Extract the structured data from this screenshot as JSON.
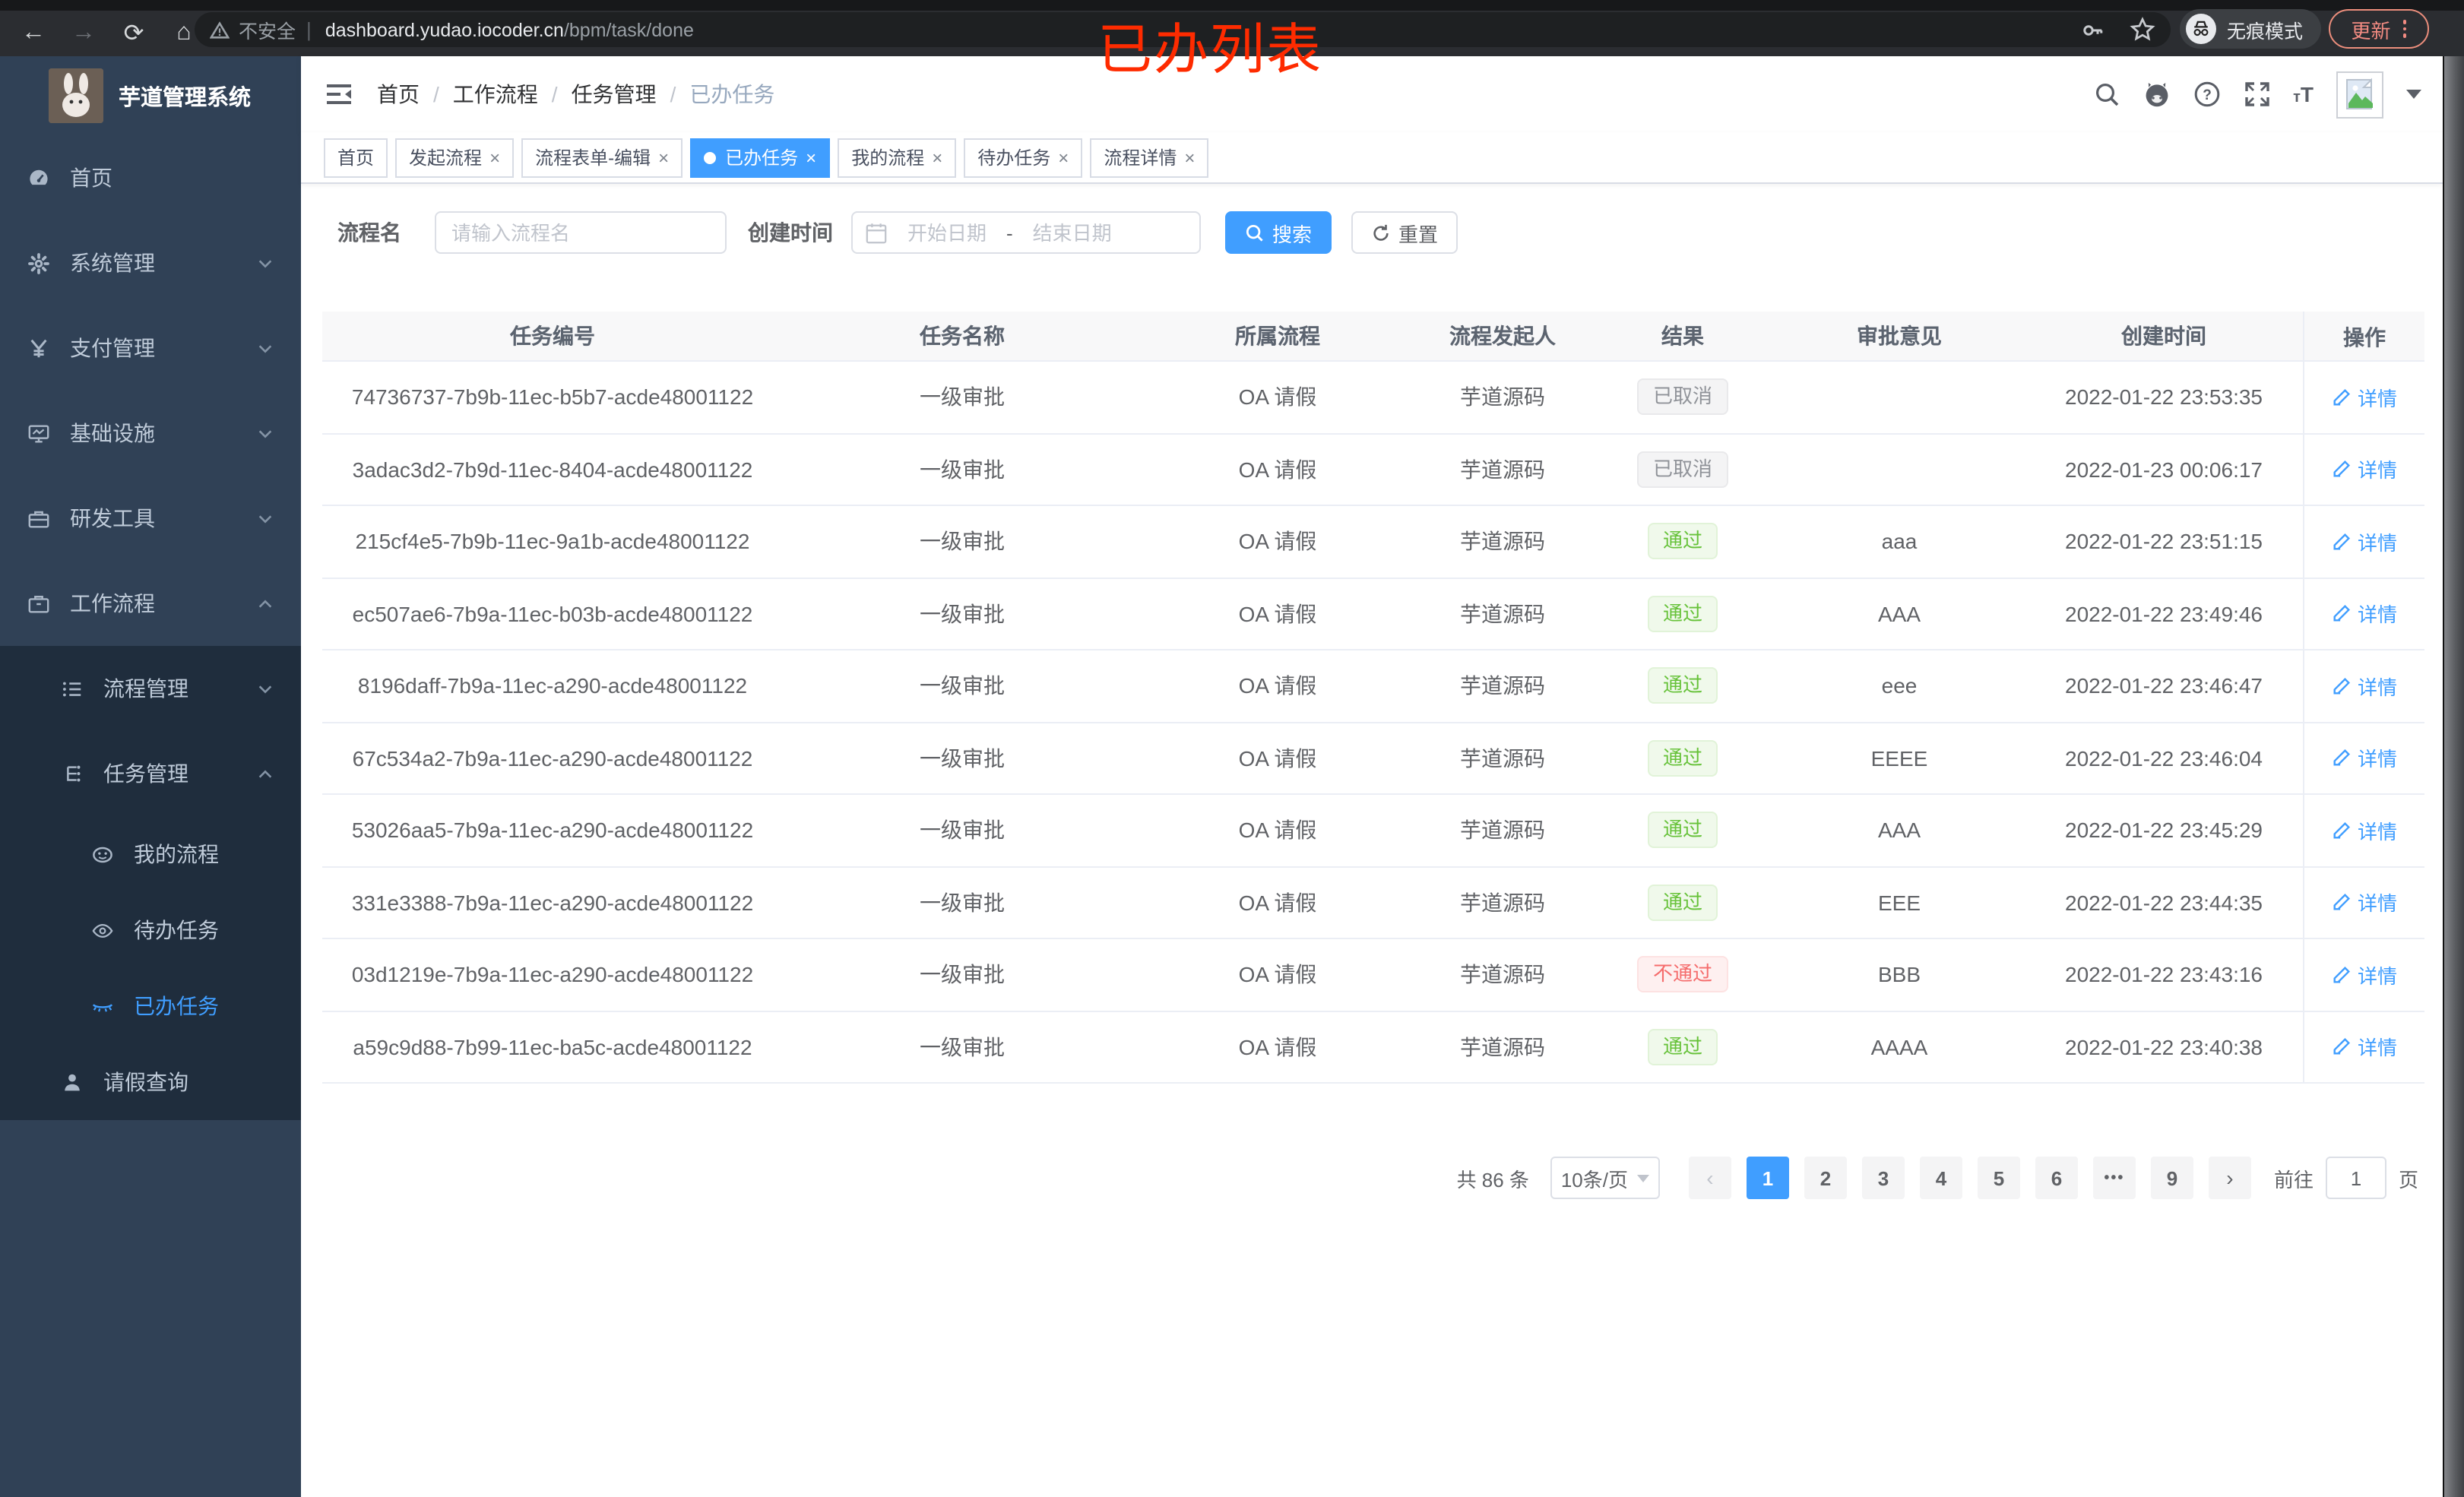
{
  "annotation": {
    "text": "已办列表"
  },
  "browser": {
    "security": "不安全",
    "url_host": "dashboard.yudao.iocoder.cn",
    "url_path": "/bpm/task/done",
    "incognito_label": "无痕模式",
    "update_label": "更新"
  },
  "sidebar": {
    "title": "芋道管理系统",
    "items": [
      {
        "label": "首页"
      },
      {
        "label": "系统管理"
      },
      {
        "label": "支付管理"
      },
      {
        "label": "基础设施"
      },
      {
        "label": "研发工具"
      },
      {
        "label": "工作流程"
      },
      {
        "label": "流程管理"
      },
      {
        "label": "任务管理"
      },
      {
        "label": "我的流程"
      },
      {
        "label": "待办任务"
      },
      {
        "label": "已办任务"
      },
      {
        "label": "请假查询"
      }
    ]
  },
  "breadcrumb": {
    "items": [
      "首页",
      "工作流程",
      "任务管理",
      "已办任务"
    ],
    "separator": "/"
  },
  "tabs": [
    {
      "label": "首页"
    },
    {
      "label": "发起流程",
      "close": "×"
    },
    {
      "label": "流程表单-编辑",
      "close": "×"
    },
    {
      "label": "已办任务",
      "close": "×",
      "active": true
    },
    {
      "label": "我的流程",
      "close": "×"
    },
    {
      "label": "待办任务",
      "close": "×"
    },
    {
      "label": "流程详情",
      "close": "×"
    }
  ],
  "filter": {
    "name_label": "流程名",
    "name_placeholder": "请输入流程名",
    "date_label": "创建时间",
    "date_start_placeholder": "开始日期",
    "date_separator": "-",
    "date_end_placeholder": "结束日期",
    "search_label": "搜索",
    "reset_label": "重置"
  },
  "table": {
    "columns": [
      "任务编号",
      "任务名称",
      "所属流程",
      "流程发起人",
      "结果",
      "审批意见",
      "创建时间",
      "操作"
    ],
    "rows": [
      {
        "id": "74736737-7b9b-11ec-b5b7-acde48001122",
        "name": "一级审批",
        "process": "OA 请假",
        "starter": "芋道源码",
        "result": "已取消",
        "result_type": "info",
        "opinion": "",
        "created": "2022-01-22 23:53:35",
        "action_label": "详情"
      },
      {
        "id": "3adac3d2-7b9d-11ec-8404-acde48001122",
        "name": "一级审批",
        "process": "OA 请假",
        "starter": "芋道源码",
        "result": "已取消",
        "result_type": "info",
        "opinion": "",
        "created": "2022-01-23 00:06:17",
        "action_label": "详情"
      },
      {
        "id": "215cf4e5-7b9b-11ec-9a1b-acde48001122",
        "name": "一级审批",
        "process": "OA 请假",
        "starter": "芋道源码",
        "result": "通过",
        "result_type": "success",
        "opinion": "aaa",
        "created": "2022-01-22 23:51:15",
        "action_label": "详情"
      },
      {
        "id": "ec507ae6-7b9a-11ec-b03b-acde48001122",
        "name": "一级审批",
        "process": "OA 请假",
        "starter": "芋道源码",
        "result": "通过",
        "result_type": "success",
        "opinion": "AAA",
        "created": "2022-01-22 23:49:46",
        "action_label": "详情"
      },
      {
        "id": "8196daff-7b9a-11ec-a290-acde48001122",
        "name": "一级审批",
        "process": "OA 请假",
        "starter": "芋道源码",
        "result": "通过",
        "result_type": "success",
        "opinion": "eee",
        "created": "2022-01-22 23:46:47",
        "action_label": "详情"
      },
      {
        "id": "67c534a2-7b9a-11ec-a290-acde48001122",
        "name": "一级审批",
        "process": "OA 请假",
        "starter": "芋道源码",
        "result": "通过",
        "result_type": "success",
        "opinion": "EEEE",
        "created": "2022-01-22 23:46:04",
        "action_label": "详情"
      },
      {
        "id": "53026aa5-7b9a-11ec-a290-acde48001122",
        "name": "一级审批",
        "process": "OA 请假",
        "starter": "芋道源码",
        "result": "通过",
        "result_type": "success",
        "opinion": "AAA",
        "created": "2022-01-22 23:45:29",
        "action_label": "详情"
      },
      {
        "id": "331e3388-7b9a-11ec-a290-acde48001122",
        "name": "一级审批",
        "process": "OA 请假",
        "starter": "芋道源码",
        "result": "通过",
        "result_type": "success",
        "opinion": "EEE",
        "created": "2022-01-22 23:44:35",
        "action_label": "详情"
      },
      {
        "id": "03d1219e-7b9a-11ec-a290-acde48001122",
        "name": "一级审批",
        "process": "OA 请假",
        "starter": "芋道源码",
        "result": "不通过",
        "result_type": "danger",
        "opinion": "BBB",
        "created": "2022-01-22 23:43:16",
        "action_label": "详情"
      },
      {
        "id": "a59c9d88-7b99-11ec-ba5c-acde48001122",
        "name": "一级审批",
        "process": "OA 请假",
        "starter": "芋道源码",
        "result": "通过",
        "result_type": "success",
        "opinion": "AAAA",
        "created": "2022-01-22 23:40:38",
        "action_label": "详情"
      }
    ]
  },
  "pagination": {
    "total": "共 86 条",
    "page_size": "10条/页",
    "prev": "‹",
    "next": "›",
    "pages": [
      "1",
      "2",
      "3",
      "4",
      "5",
      "6",
      "•••",
      "9"
    ],
    "active_page": "1",
    "goto_label": "前往",
    "goto_value": "1",
    "goto_unit": "页"
  }
}
